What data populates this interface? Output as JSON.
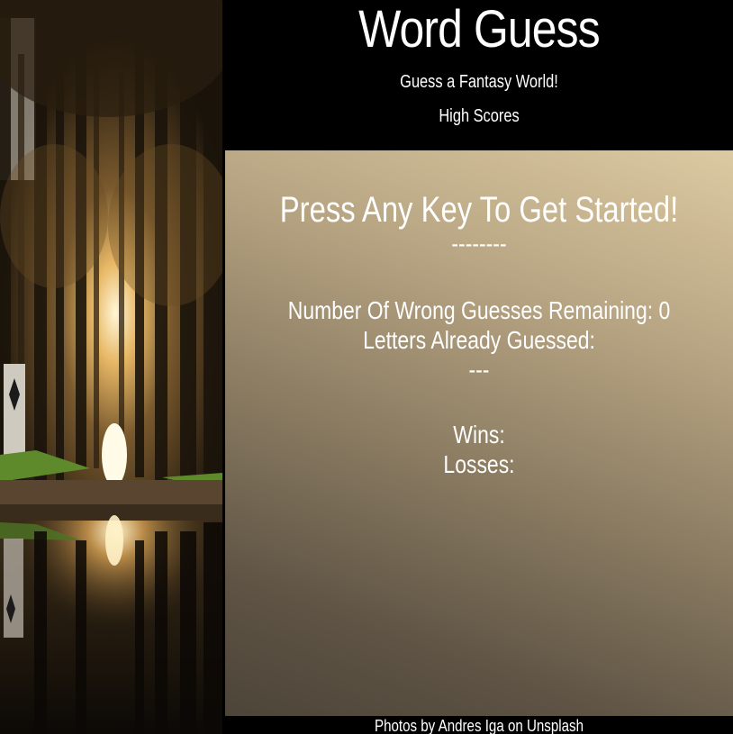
{
  "header": {
    "title": "Word Guess",
    "subtitle": "Guess a Fantasy World!",
    "high_scores_link": "High Scores"
  },
  "game": {
    "prompt": "Press Any Key To Get Started!",
    "word_placeholder": "--------",
    "wrong_guesses_label": "Number Of Wrong Guesses Remaining: 0",
    "letters_guessed_label": "Letters Already Guessed:",
    "letters_guessed_value": "---",
    "wins_label": "Wins:",
    "losses_label": "Losses:"
  },
  "footer": {
    "credit": "Photos by Andres Iga on Unsplash"
  },
  "colors": {
    "background": "#000000",
    "panel_light": "#dccaa2",
    "panel_dark": "#4d4539",
    "text": "#ffffff"
  }
}
